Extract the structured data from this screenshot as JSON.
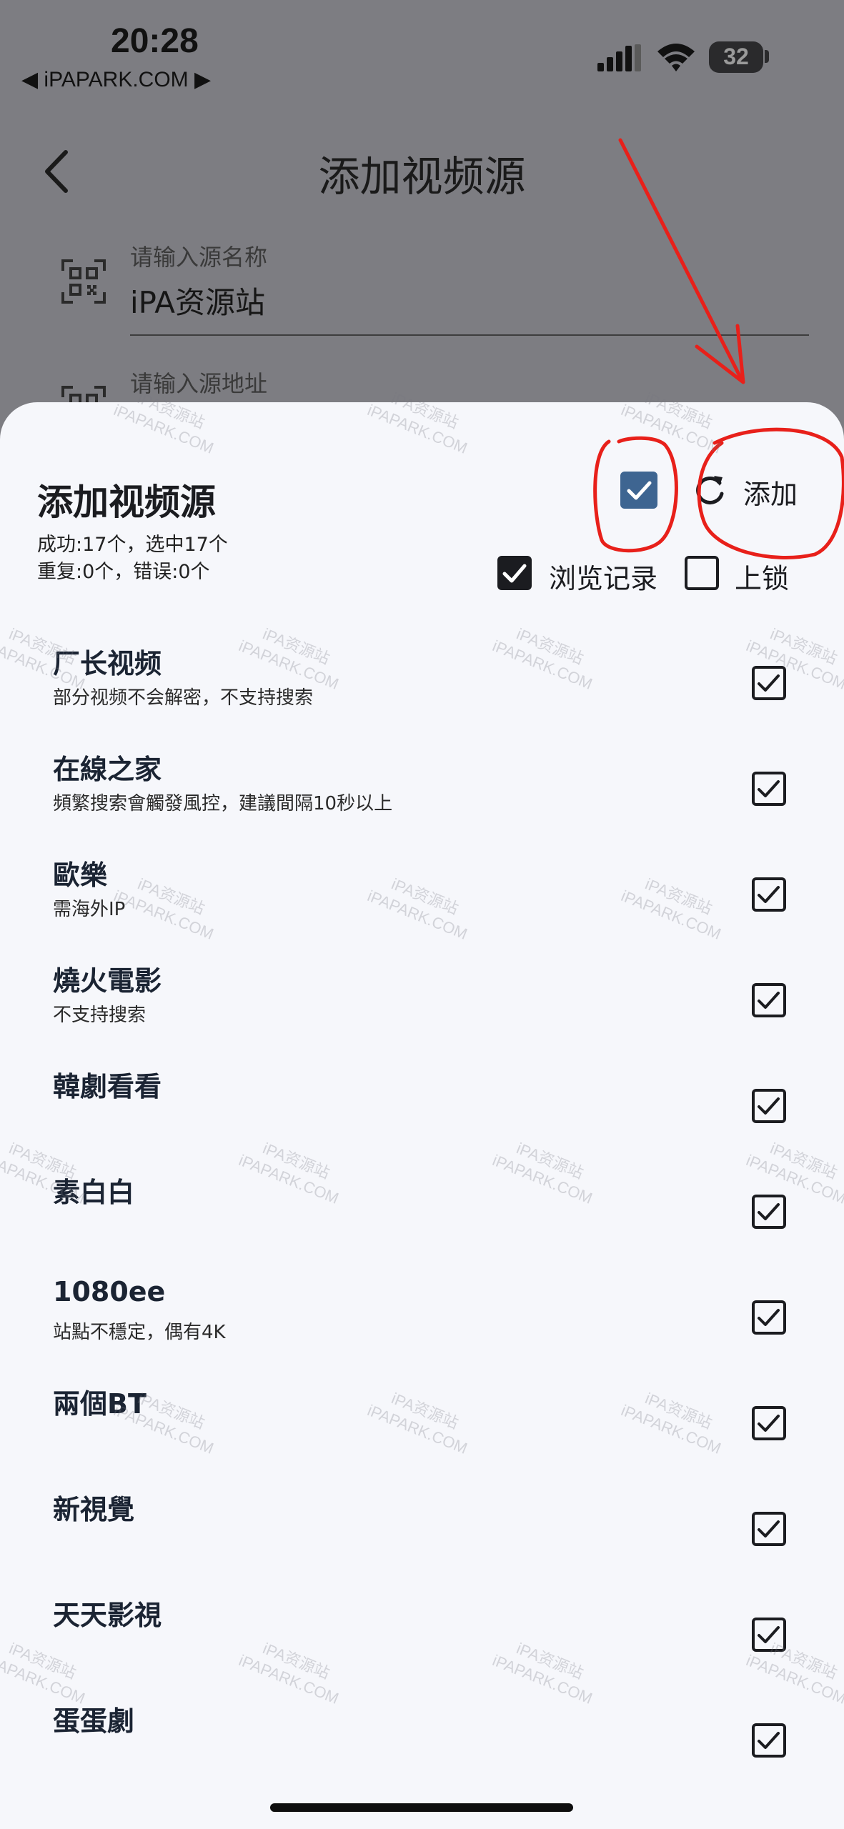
{
  "status_bar": {
    "time": "20:28",
    "carrier": "◀ iPAPARK.COM ▶",
    "battery": "32"
  },
  "background_page": {
    "title": "添加视频源",
    "name_field": {
      "label": "请输入源名称",
      "value": "iPA资源站"
    },
    "url_field": {
      "label": "请输入源地址"
    }
  },
  "sheet": {
    "title": "添加视频源",
    "stats_line1": "成功:17个，选中17个",
    "stats_line2": "重复:0个，错误:0个",
    "add_label": "添加",
    "options": [
      {
        "label": "浏览记录",
        "checked": true
      },
      {
        "label": "上锁",
        "checked": false
      }
    ],
    "items": [
      {
        "title": "厂长视频",
        "subtitle": "部分视频不会解密，不支持搜索",
        "checked": true
      },
      {
        "title": "在線之家",
        "subtitle": "頻繁搜索會觸發風控，建議間隔10秒以上",
        "checked": true
      },
      {
        "title": "歐樂",
        "subtitle": "需海外IP",
        "checked": true
      },
      {
        "title": "燒火電影",
        "subtitle": "不支持搜索",
        "checked": true
      },
      {
        "title": "韓劇看看",
        "subtitle": "",
        "checked": true
      },
      {
        "title": "素白白",
        "subtitle": "",
        "checked": true
      },
      {
        "title": "1080ee",
        "subtitle": "站點不穩定，偶有4K",
        "checked": true
      },
      {
        "title": "兩個BT",
        "subtitle": "",
        "checked": true
      },
      {
        "title": "新視覺",
        "subtitle": "",
        "checked": true
      },
      {
        "title": "天天影視",
        "subtitle": "",
        "checked": true
      },
      {
        "title": "蛋蛋劇",
        "subtitle": "",
        "checked": true
      }
    ]
  },
  "watermark": {
    "line1": "iPA资源站",
    "line2": "iPAPARK.COM"
  },
  "colors": {
    "scrim": "#7d7d82",
    "sheet_bg": "#f6f7fb",
    "accent_check": "#3e6591",
    "annotation_red": "#e8201a"
  }
}
